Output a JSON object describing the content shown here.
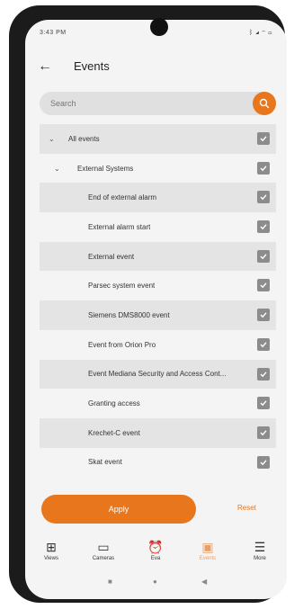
{
  "status_bar": {
    "time_and_icons": "3:43 PM",
    "right_icons": "ᛒ ◢ ◠ ▭"
  },
  "header": {
    "back_icon": "←",
    "title": "Events"
  },
  "search": {
    "placeholder": "Search"
  },
  "tree": [
    {
      "label": "All events",
      "level": 0,
      "expandable": true,
      "checked": true
    },
    {
      "label": "External Systems",
      "level": 1,
      "expandable": true,
      "checked": true
    },
    {
      "label": "End of external alarm",
      "level": 2,
      "expandable": false,
      "checked": true
    },
    {
      "label": "External alarm start",
      "level": 2,
      "expandable": false,
      "checked": true
    },
    {
      "label": "External event",
      "level": 2,
      "expandable": false,
      "checked": true
    },
    {
      "label": "Parsec system event",
      "level": 2,
      "expandable": false,
      "checked": true
    },
    {
      "label": "Siemens DMS8000 event",
      "level": 2,
      "expandable": false,
      "checked": true
    },
    {
      "label": "Event from Orion Pro",
      "level": 2,
      "expandable": false,
      "checked": true
    },
    {
      "label": "Event Mediana Security and Access Cont...",
      "level": 2,
      "expandable": false,
      "checked": true
    },
    {
      "label": "Granting access",
      "level": 2,
      "expandable": false,
      "checked": true
    },
    {
      "label": "Krechet-C event",
      "level": 2,
      "expandable": false,
      "checked": true
    },
    {
      "label": "Skat event",
      "level": 2,
      "expandable": false,
      "checked": true
    }
  ],
  "actions": {
    "apply_label": "Apply",
    "reset_label": "Reset"
  },
  "bottom_nav": [
    {
      "label": "Views",
      "icon": "grid-icon",
      "active": false
    },
    {
      "label": "Cameras",
      "icon": "camera-icon",
      "active": false
    },
    {
      "label": "Eva",
      "icon": "alarm-clock-icon",
      "active": false
    },
    {
      "label": "Events",
      "icon": "events-icon",
      "active": true
    },
    {
      "label": "More",
      "icon": "menu-icon",
      "active": false
    }
  ],
  "colors": {
    "accent": "#e8761c",
    "checkbox": "#8c8c8c",
    "row_alt": "#e4e4e4"
  }
}
